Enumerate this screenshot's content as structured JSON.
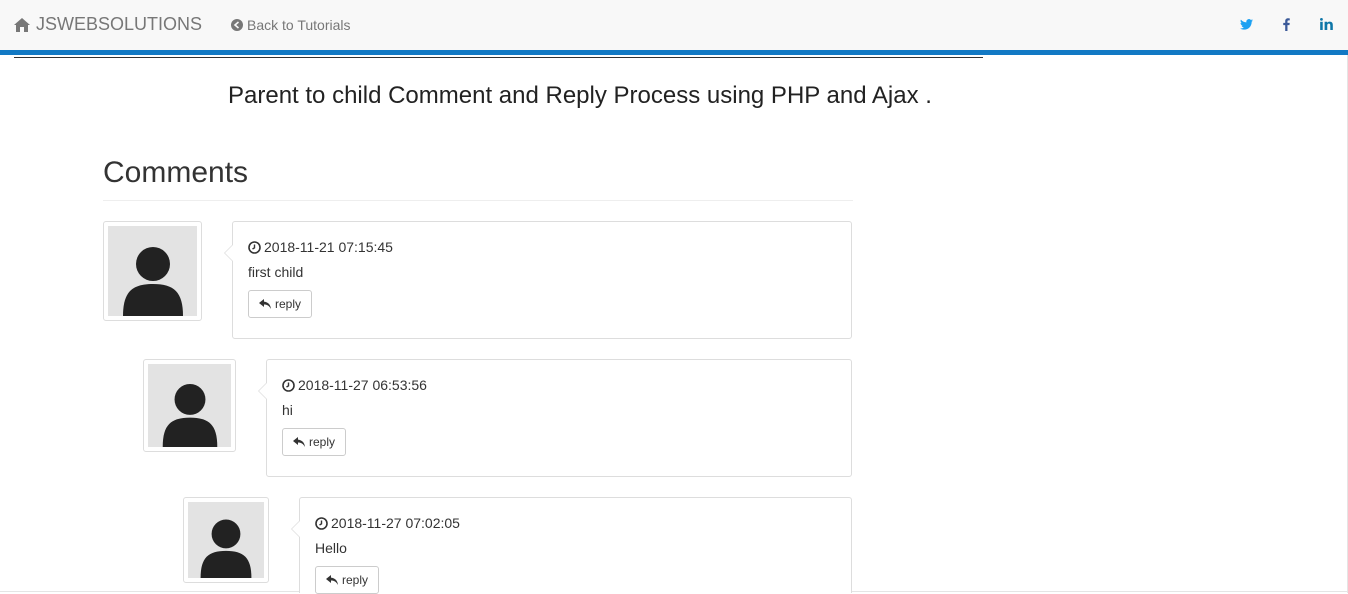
{
  "navbar": {
    "brand": "JSWEBSOLUTIONS",
    "back_link": "Back to Tutorials",
    "social": [
      "twitter-icon",
      "facebook-icon",
      "linkedin-icon"
    ]
  },
  "page": {
    "title": "Parent to child Comment and Reply Process using PHP and Ajax .",
    "comments_heading": "Comments"
  },
  "comments": [
    {
      "timestamp": "2018-11-21 07:15:45",
      "text": "first child",
      "reply_label": "reply"
    },
    {
      "timestamp": "2018-11-27 06:53:56",
      "text": "hi",
      "reply_label": "reply"
    },
    {
      "timestamp": "2018-11-27 07:02:05",
      "text": "Hello",
      "reply_label": "reply"
    }
  ],
  "colors": {
    "accent": "#1279c4",
    "social": "#1da1f2",
    "facebook": "#3b5998",
    "linkedin": "#0e76a8"
  }
}
